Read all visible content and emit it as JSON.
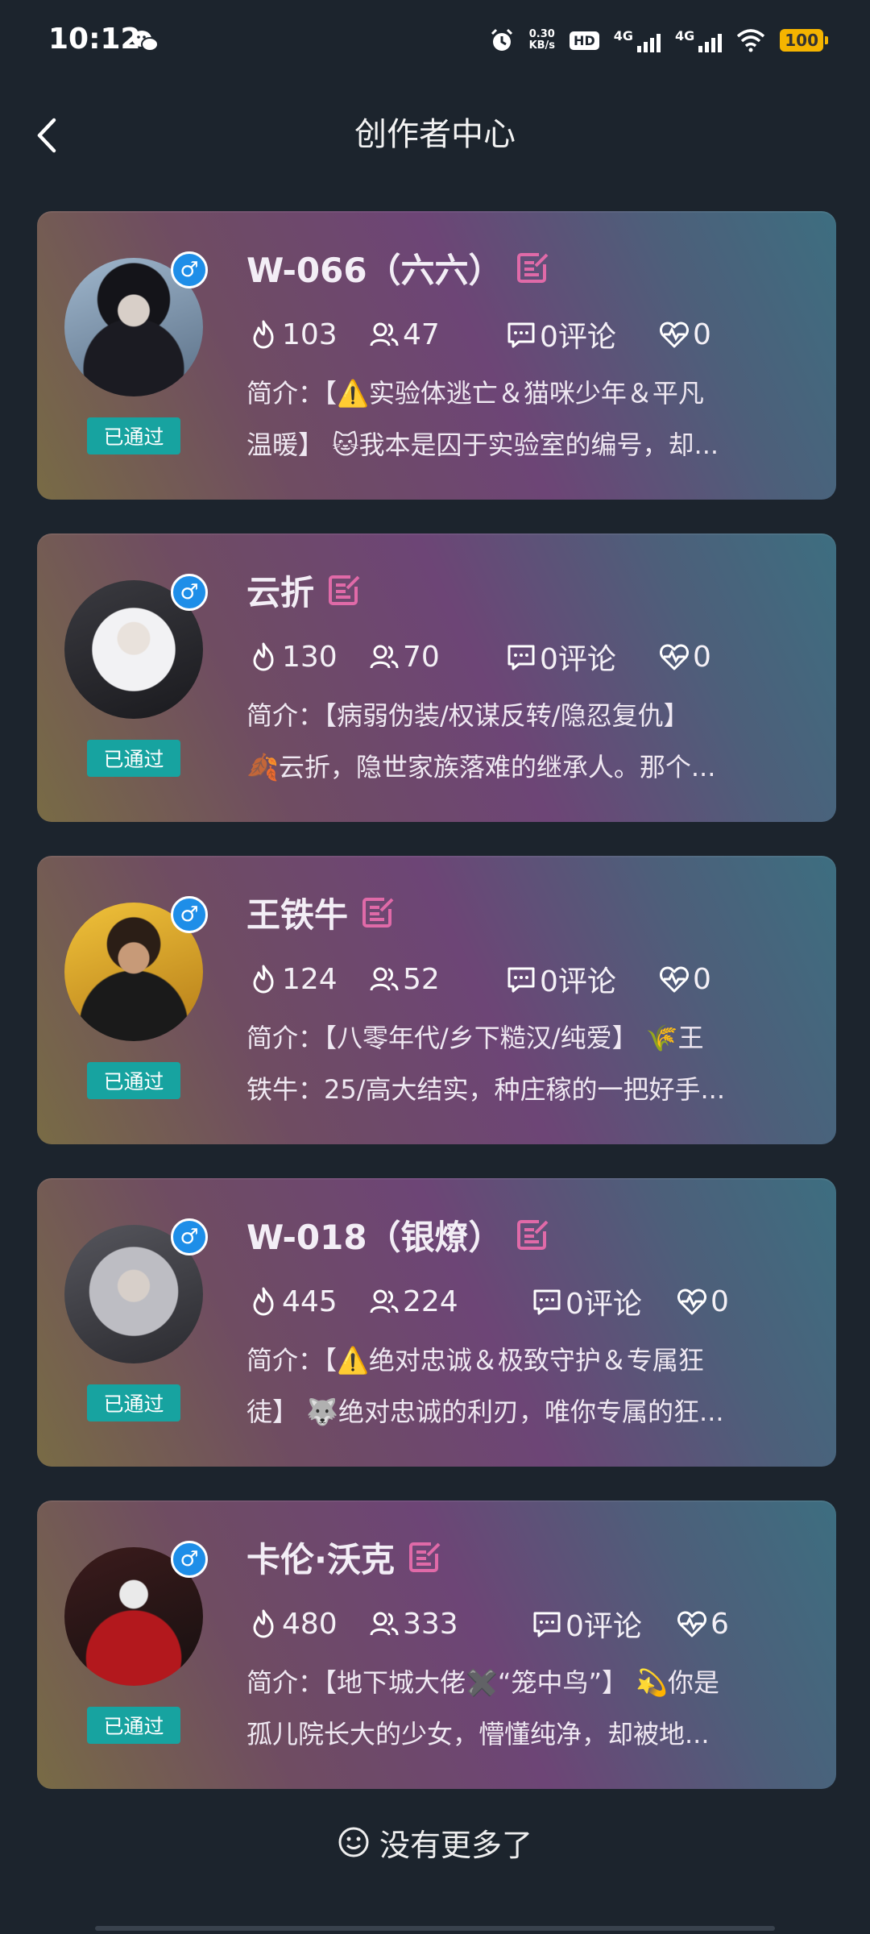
{
  "status_bar": {
    "time": "10:12",
    "net_speed_value": "0.30",
    "net_speed_unit": "KB/s",
    "hd_label": "HD",
    "signal1_label": "4G",
    "signal2_label": "4G",
    "battery": "100"
  },
  "header": {
    "title": "创作者中心"
  },
  "labels": {
    "intro_prefix": "简介："
  },
  "cards": [
    {
      "name": "W-066（六六）",
      "heat": "103",
      "fans": "47",
      "comments": "0评论",
      "likes": "0",
      "status": "已通过",
      "gender_icon": "♂",
      "intro_line1": "【⚠️实验体逃亡＆猫咪少年＆平凡",
      "intro_line2": "温暖】 🐱我本是囚于实验室的编号，却..."
    },
    {
      "name": "云折",
      "heat": "130",
      "fans": "70",
      "comments": "0评论",
      "likes": "0",
      "status": "已通过",
      "gender_icon": "♂",
      "intro_line1": "【病弱伪装/权谋反转/隐忍复仇】",
      "intro_line2": "🍂云折，隐世家族落难的继承人。那个..."
    },
    {
      "name": "王铁牛",
      "heat": "124",
      "fans": "52",
      "comments": "0评论",
      "likes": "0",
      "status": "已通过",
      "gender_icon": "♂",
      "intro_line1": "【八零年代/乡下糙汉/纯爱】 🌾王",
      "intro_line2": "铁牛：25/高大结实，种庄稼的一把好手..."
    },
    {
      "name": "W-018（银燎）",
      "heat": "445",
      "fans": "224",
      "comments": "0评论",
      "likes": "0",
      "status": "已通过",
      "gender_icon": "♂",
      "intro_line1": "【⚠️绝对忠诚＆极致守护＆专属狂",
      "intro_line2": "徒】 🐺绝对忠诚的利刃，唯你专属的狂..."
    },
    {
      "name": "卡伦·沃克",
      "heat": "480",
      "fans": "333",
      "comments": "0评论",
      "likes": "6",
      "status": "已通过",
      "gender_icon": "♂",
      "intro_line1": "【地下城大佬✖️“笼中鸟”】 💫你是",
      "intro_line2": "孤儿院长大的少女，懵懂纯净，却被地..."
    }
  ],
  "footer": {
    "no_more": "没有更多了"
  },
  "colors": {
    "background": "#1c242d",
    "edit_icon": "#e06aa8",
    "approved_badge": "#17a3a0",
    "gender_badge": "#1e8ee8"
  }
}
